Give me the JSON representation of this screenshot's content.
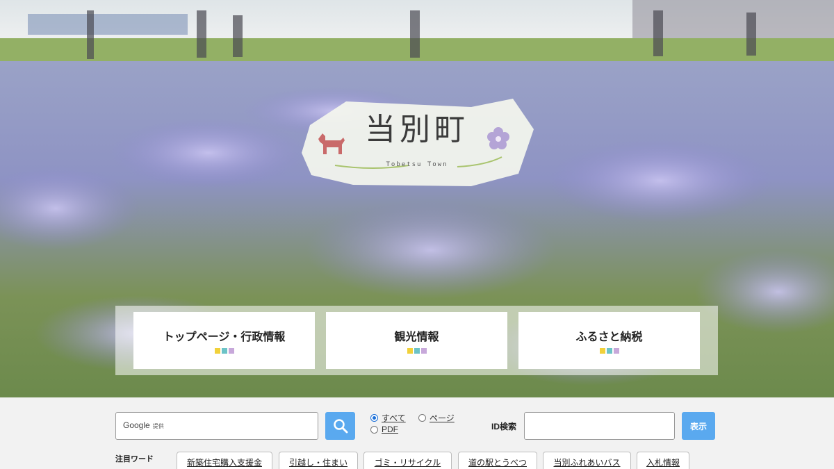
{
  "hero": {
    "logo": {
      "title": "当別町",
      "subtitle": "Tobetsu Town",
      "horse_color": "#c96a6a",
      "flower_color": "#b4a4d6"
    }
  },
  "nav": {
    "cards": [
      {
        "label": "トップページ・行政情報"
      },
      {
        "label": "観光情報"
      },
      {
        "label": "ふるさと納税"
      }
    ],
    "swatch_colors": [
      "#f1d13a",
      "#6cc3c7",
      "#c7a8da"
    ]
  },
  "search": {
    "google_label": "Google",
    "google_sub": "提供",
    "search_icon": "magnifier-icon",
    "radios": [
      {
        "label": "すべて",
        "checked": true
      },
      {
        "label": "ページ",
        "checked": false
      },
      {
        "label": "PDF",
        "checked": false
      }
    ],
    "id_label": "ID検索",
    "show_button": "表示",
    "accent_color": "#5aa9ef"
  },
  "keywords": {
    "label": "注目ワード",
    "items": [
      "新築住宅購入支援金",
      "引越し・住まい",
      "ゴミ・リサイクル",
      "道の駅とうべつ",
      "当別ふれあいバス",
      "入札情報"
    ]
  }
}
